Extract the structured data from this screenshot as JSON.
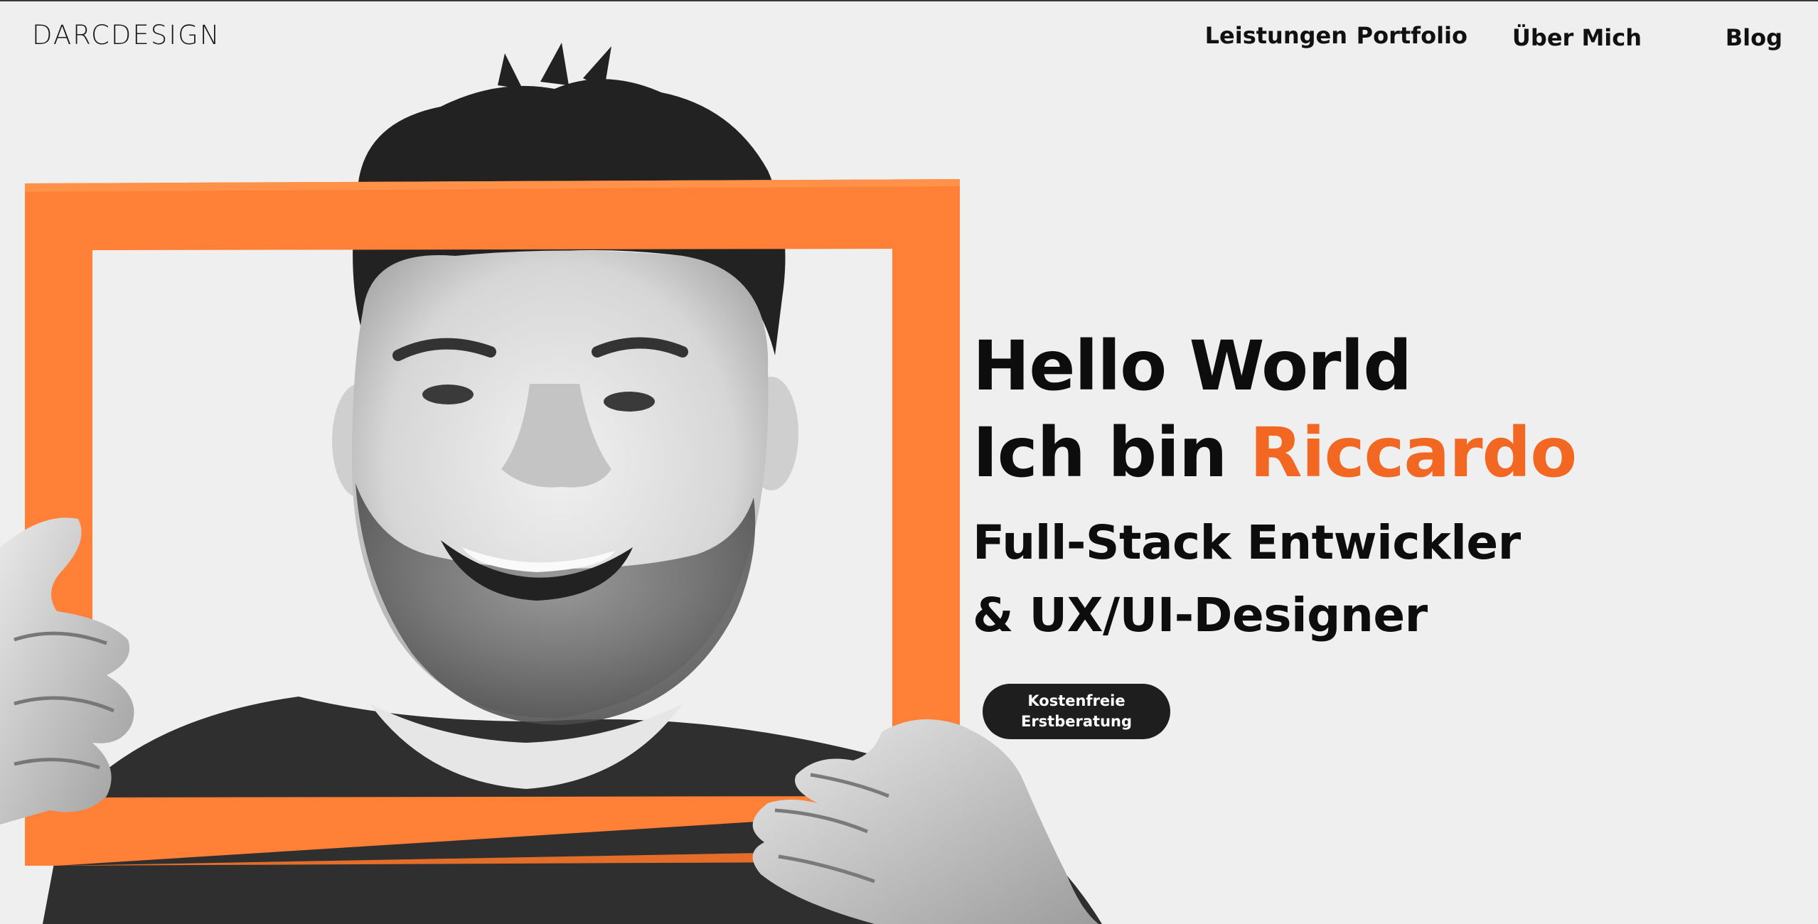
{
  "header": {
    "logo_text": "DARCDESIGN",
    "nav": [
      {
        "label": "Leistungen"
      },
      {
        "label": "Portfolio"
      },
      {
        "label": "Über Mich"
      },
      {
        "label": "Blog"
      }
    ]
  },
  "hero": {
    "line1": "Hello World",
    "line2_prefix": "Ich bin ",
    "line2_name": "Riccardo",
    "subtitle_line1": "Full-Stack Entwickler",
    "subtitle_line2": "& UX/UI-Designer",
    "cta_line1": "Kostenfreie",
    "cta_line2": "Erstberatung"
  },
  "colors": {
    "accent": "#f26722",
    "frame": "#ff8036",
    "background": "#efefef",
    "text": "#0d0d0d",
    "button": "#1e1e1e"
  },
  "icons": {
    "portrait": "person-holding-frame-photo"
  }
}
